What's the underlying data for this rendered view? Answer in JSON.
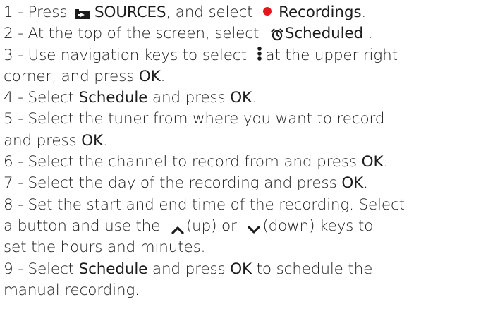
{
  "colors": {
    "text": "#1c1c1c",
    "recordings_dot": "#e8141e"
  },
  "icons": {
    "sources": "sources-input-icon",
    "recordings": "record-dot-icon",
    "scheduled": "alarm-clock-icon",
    "menu": "vertical-ellipsis-icon",
    "up": "chevron-up-icon",
    "down": "chevron-down-icon"
  },
  "steps": {
    "s1": {
      "num": "1 - ",
      "a": " Press ",
      "key1": "SOURCES",
      "b": ", and select ",
      "key2": "Recordings",
      "c": "."
    },
    "s2": {
      "num": "2 - ",
      "a": " At the top of the screen, select ",
      "key1": "Scheduled",
      "b": " ."
    },
    "s3": {
      "num": "3 - ",
      "a": " Use navigation keys to select ",
      "b": "at the upper right",
      "cont": "corner, and press ",
      "key1": "OK",
      "c": "."
    },
    "s4": {
      "num": "4 - ",
      "a": " Select ",
      "key1": "Schedule",
      "b": " and press ",
      "key2": "OK",
      "c": "."
    },
    "s5": {
      "num": "5 - ",
      "a": " Select the tuner from where you want to record",
      "cont": "and press ",
      "key1": "OK",
      "c": "."
    },
    "s6": {
      "num": "6 - ",
      "a": " Select the channel to record from and press ",
      "key1": "OK",
      "c": "."
    },
    "s7": {
      "num": "7 - ",
      "a": " Select the day of the recording and press ",
      "key1": "OK",
      "c": "."
    },
    "s8": {
      "num": "8 - ",
      "a": " Set the start and end time of the recording. Select",
      "cont": "a button and use the ",
      "up": "(up) or ",
      "down": "(down) keys to",
      "cont2": "set the hours and minutes."
    },
    "s9": {
      "num": "9 - ",
      "a": " Select ",
      "key1": "Schedule",
      "b": " and press ",
      "key2": "OK",
      "c": " to schedule the",
      "cont": "manual recording."
    }
  }
}
